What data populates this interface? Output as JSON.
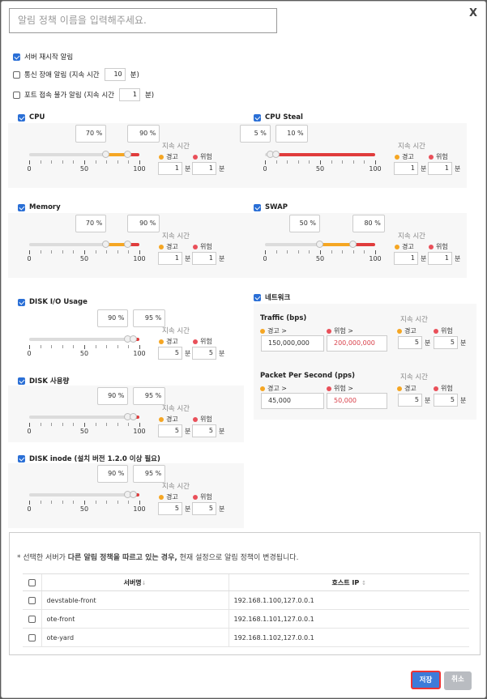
{
  "header": {
    "name_placeholder": "알림 정책 이름을 입력해주세요.",
    "close_label": "X"
  },
  "options": {
    "server_restart": {
      "label": "서버 재시작 알림",
      "checked": true
    },
    "comm_failure": {
      "label": "통신 장애 알림",
      "prefix": "(지속 시간",
      "value": "10",
      "suffix": "분)",
      "checked": false
    },
    "port_connect": {
      "label": "포트 접속 불가 알림",
      "prefix": "(지속 시간",
      "value": "1",
      "suffix": "분)",
      "checked": false
    }
  },
  "common": {
    "duration_title": "지속 시간",
    "warn_label": "경고",
    "crit_label": "위험",
    "minute_unit": "분",
    "ticks": [
      "0",
      "50",
      "100"
    ]
  },
  "metrics": {
    "cpu": {
      "label": "CPU",
      "warn_pct": "70 %",
      "crit_pct": "90 %",
      "warn": 70,
      "crit": 90,
      "warn_min": "1",
      "crit_min": "1"
    },
    "cpu_steal": {
      "label": "CPU Steal",
      "warn_pct": "5 %",
      "crit_pct": "10 %",
      "warn": 5,
      "crit": 10,
      "warn_min": "1",
      "crit_min": "1"
    },
    "memory": {
      "label": "Memory",
      "warn_pct": "70 %",
      "crit_pct": "90 %",
      "warn": 70,
      "crit": 90,
      "warn_min": "1",
      "crit_min": "1"
    },
    "swap": {
      "label": "SWAP",
      "warn_pct": "50 %",
      "crit_pct": "80 %",
      "warn": 50,
      "crit": 80,
      "warn_min": "1",
      "crit_min": "1"
    },
    "disk_io": {
      "label": "DISK I/O Usage",
      "warn_pct": "90 %",
      "crit_pct": "95 %",
      "warn": 90,
      "crit": 95,
      "warn_min": "5",
      "crit_min": "5"
    },
    "disk_usage": {
      "label": "DISK 사용량",
      "warn_pct": "90 %",
      "crit_pct": "95 %",
      "warn": 90,
      "crit": 95,
      "warn_min": "5",
      "crit_min": "5"
    },
    "disk_inode": {
      "label": "DISK inode (설치 버전 1.2.0 이상 필요)",
      "warn_pct": "90 %",
      "crit_pct": "95 %",
      "warn": 90,
      "crit": 95,
      "warn_min": "5",
      "crit_min": "5"
    }
  },
  "network": {
    "label": "네트워크",
    "traffic": {
      "title": "Traffic (bps)",
      "warn_label": "경고 >",
      "crit_label": "위험 >",
      "warn_value": "150,000,000",
      "crit_value": "200,000,000",
      "warn_min": "5",
      "crit_min": "5"
    },
    "pps": {
      "title": "Packet Per Second (pps)",
      "warn_label": "경고 >",
      "crit_label": "위험 >",
      "warn_value": "45,000",
      "crit_value": "50,000",
      "warn_min": "5",
      "crit_min": "5"
    }
  },
  "notice": {
    "prefix": "* 선택한 서버가 ",
    "bold": "다른 알림 정책을 따르고 있는 경우,",
    "suffix": " 현재 설정으로 알림 정책이 변경됩니다."
  },
  "servers": {
    "col_name": "서버명",
    "col_ip": "호스트 IP",
    "rows": [
      {
        "name": "devstable-front",
        "ip": "192.168.1.100,127.0.0.1"
      },
      {
        "name": "ote-front",
        "ip": "192.168.1.101,127.0.0.1"
      },
      {
        "name": "ote-yard",
        "ip": "192.168.1.102,127.0.0.1"
      }
    ]
  },
  "footer": {
    "save_label": "저장",
    "cancel_label": "취소"
  },
  "colors": {
    "accent": "#3d7bd9",
    "warn": "#f5a623",
    "crit": "#e03c3c",
    "track": "#dddddd"
  }
}
